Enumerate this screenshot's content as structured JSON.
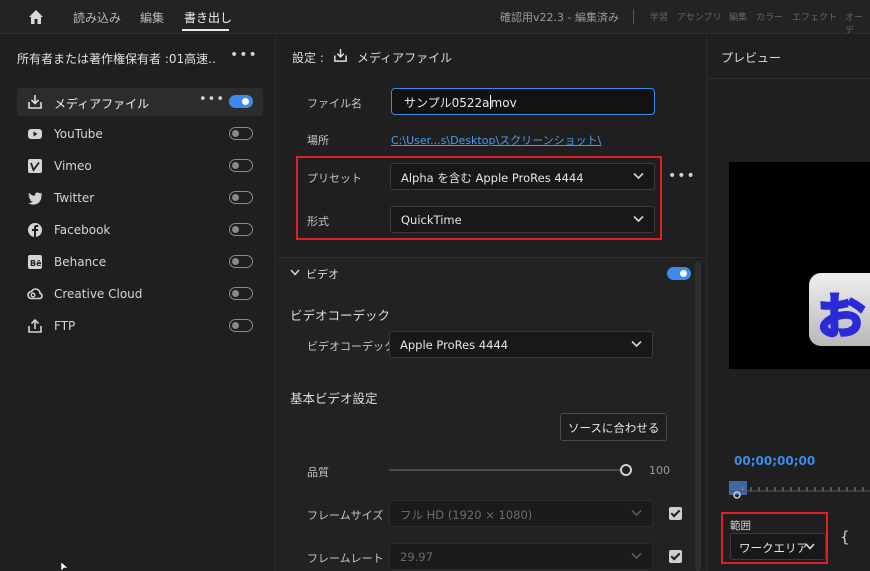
{
  "nav": {
    "tabs": [
      "読み込み",
      "編集",
      "書き出し"
    ],
    "project": "確認用v22.3 - 編集済み",
    "workspaces": [
      "学習",
      "アセンブリ",
      "編集",
      "カラー",
      "エフェクト",
      "オーデ"
    ]
  },
  "sidebar": {
    "owner": "所有者または著作権保有者 :01高速...",
    "items": [
      {
        "label": "メディアファイル",
        "icon": "media-file-export-icon",
        "enabled": true
      },
      {
        "label": "YouTube",
        "icon": "youtube-icon",
        "enabled": false
      },
      {
        "label": "Vimeo",
        "icon": "vimeo-icon",
        "enabled": false
      },
      {
        "label": "Twitter",
        "icon": "twitter-bird-icon",
        "enabled": false
      },
      {
        "label": "Facebook",
        "icon": "facebook-icon",
        "enabled": false
      },
      {
        "label": "Behance",
        "icon": "behance-icon",
        "enabled": false
      },
      {
        "label": "Creative Cloud",
        "icon": "creative-cloud-icon",
        "enabled": false
      },
      {
        "label": "FTP",
        "icon": "ftp-upload-icon",
        "enabled": false
      }
    ]
  },
  "settings": {
    "title": "設定 :",
    "target": "メディアファイル",
    "filename_label": "ファイル名",
    "filename_value": "サンプル0522a",
    "filename_ext": "mov",
    "location_label": "場所",
    "location_value": "C:\\User...s\\Desktop\\スクリーンショット\\",
    "preset_label": "プリセット",
    "preset_value": "Alpha を含む Apple ProRes 4444",
    "format_label": "形式",
    "format_value": "QuickTime"
  },
  "video": {
    "section": "ビデオ",
    "enabled": true,
    "codec_heading": "ビデオコーデック",
    "codec_label": "ビデオコーデック",
    "codec_value": "Apple ProRes 4444",
    "basic_heading": "基本ビデオ設定",
    "match_source": "ソースに合わせる",
    "quality_label": "品質",
    "quality_value": "100",
    "quality_fraction": 1.0,
    "framesize_label": "フレームサイズ",
    "framesize_value": "フル HD (1920 × 1080)",
    "framerate_label": "フレームレート",
    "framerate_value": "29.97"
  },
  "preview": {
    "title": "プレビュー",
    "timecode": "00;00;00;00",
    "range_label": "範囲",
    "range_value": "ワークエリア",
    "thumb_glyph": "お"
  },
  "colors": {
    "accent": "#3b8beb",
    "highlight": "#e01f26"
  }
}
